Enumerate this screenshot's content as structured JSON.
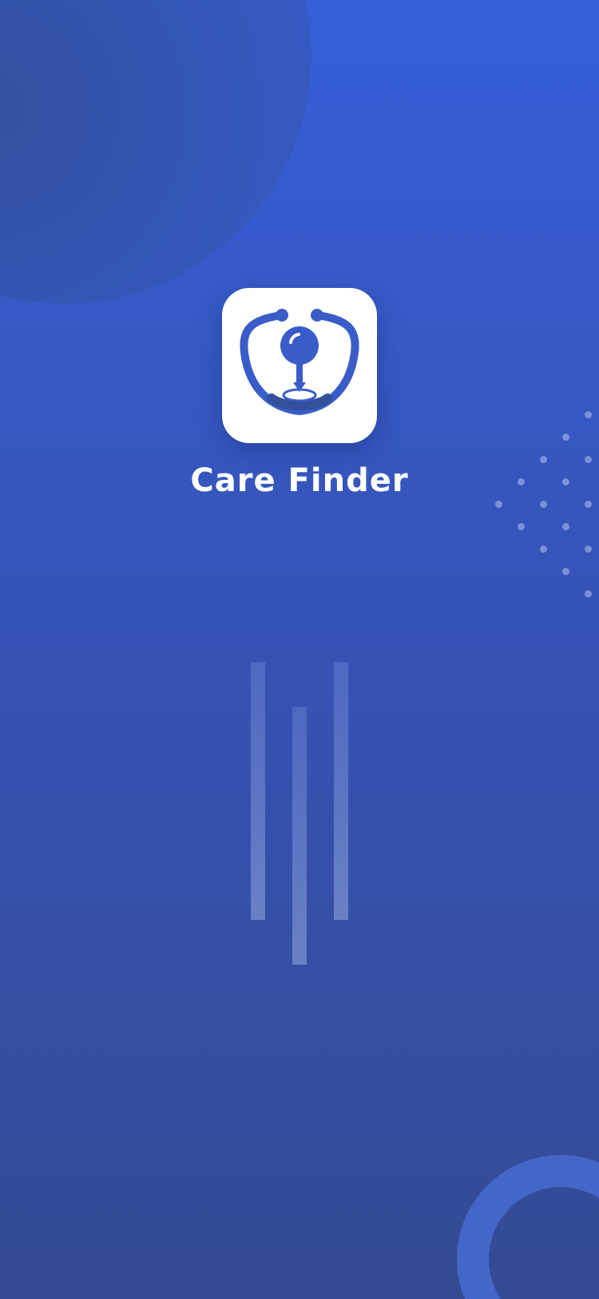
{
  "app": {
    "name": "Care Finder",
    "icon": "stethoscope-location-pin-icon"
  },
  "colors": {
    "background_top": "#365fd8",
    "background_bottom": "#344a92",
    "icon_tile": "#ffffff",
    "icon_glyph": "#3a5cc8",
    "title_text": "#ffffff"
  },
  "decorations": {
    "top_left": "circle-blob",
    "bottom_right": "ring",
    "right_edge": "dot-grid",
    "center": "vertical-bars"
  }
}
